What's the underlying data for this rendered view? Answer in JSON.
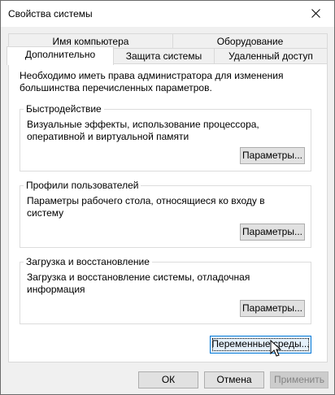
{
  "window": {
    "title": "Свойства системы"
  },
  "tabs": {
    "back_row": [
      "Имя компьютера",
      "Оборудование"
    ],
    "front_row": [
      "Дополнительно",
      "Защита системы",
      "Удаленный доступ"
    ],
    "active": "Дополнительно"
  },
  "panel": {
    "info": "Необходимо иметь права администратора для изменения большинства перечисленных параметров.",
    "groups": [
      {
        "legend": "Быстродействие",
        "description": "Визуальные эффекты, использование процессора, оперативной и виртуальной памяти",
        "button": "Параметры..."
      },
      {
        "legend": "Профили пользователей",
        "description": "Параметры рабочего стола, относящиеся ко входу в систему",
        "button": "Параметры..."
      },
      {
        "legend": "Загрузка и восстановление",
        "description": "Загрузка и восстановление системы, отладочная информация",
        "button": "Параметры..."
      }
    ],
    "env_button": "Переменные среды..."
  },
  "footer": {
    "ok": "ОК",
    "cancel": "Отмена",
    "apply": "Применить"
  },
  "icons": {
    "close": "close-icon",
    "cursor": "mouse-pointer-icon"
  }
}
